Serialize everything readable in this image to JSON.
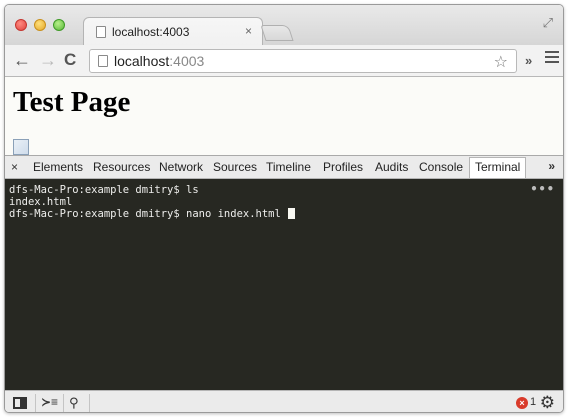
{
  "tab": {
    "title": "localhost:4003",
    "close": "×"
  },
  "toolbar": {
    "back": "←",
    "forward": "→",
    "reload": "C",
    "url_host": "localhost",
    "url_port": ":4003",
    "star": "☆",
    "extensions": "»"
  },
  "page": {
    "heading": "Test Page"
  },
  "devtools": {
    "close": "×",
    "tabs": [
      "Elements",
      "Resources",
      "Network",
      "Sources",
      "Timeline",
      "Profiles",
      "Audits",
      "Console",
      "Terminal"
    ],
    "active_tab": "Terminal",
    "more": "»",
    "terminal_lines": [
      "dfs-Mac-Pro:example dmitry$ ls",
      "index.html",
      "dfs-Mac-Pro:example dmitry$ nano index.html"
    ],
    "terminal_menu": "•••",
    "error_count": "1",
    "error_icon": "×",
    "console_drawer": "≻≡",
    "search": "⚲"
  }
}
